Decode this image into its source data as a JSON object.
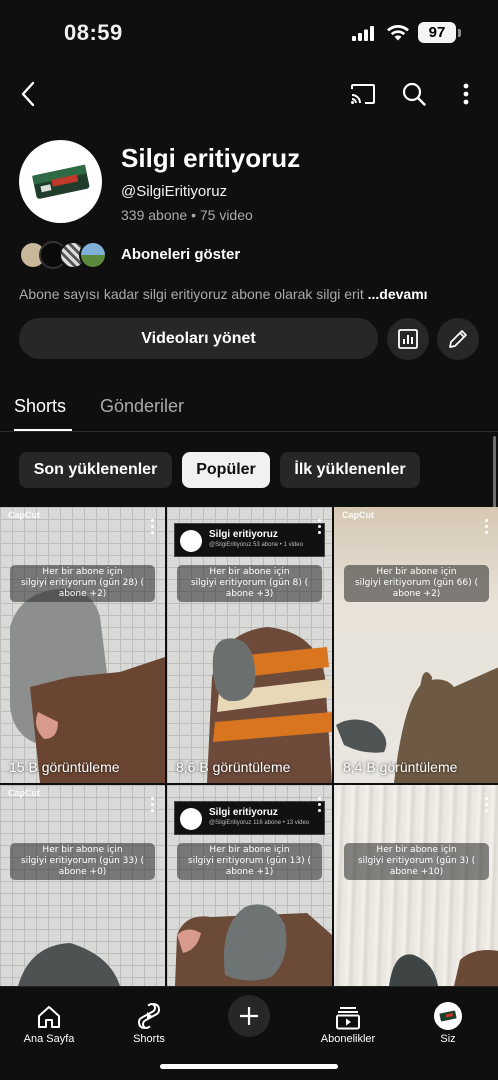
{
  "status_bar": {
    "time": "08:59",
    "battery": "97"
  },
  "channel": {
    "name": "Silgi eritiyoruz",
    "handle": "@SilgiEritiyoruz",
    "stats": "339 abone • 75 video",
    "show_subscribers_label": "Aboneleri göster",
    "description": "Abone sayısı kadar silgi eritiyoruz abone olarak silgi erit",
    "more_label": "...devamı",
    "manage_videos_label": "Videoları yönet"
  },
  "tabs": [
    {
      "label": "Shorts"
    },
    {
      "label": "Gönderiler"
    }
  ],
  "chips": [
    {
      "label": "Son yüklenenler"
    },
    {
      "label": "Popüler"
    },
    {
      "label": "İlk yüklenenler"
    }
  ],
  "shorts": [
    {
      "caption": "Her bir abone için\nsilgiyi eritiyorum (gün 28) ( abone +2)",
      "views": "15 B görüntüleme",
      "watermark": "CapCut",
      "bg": "grid"
    },
    {
      "caption": "Her bir abone için\nsilgiyi eritiyorum (gün 8) ( abone +3)",
      "views": "8,6 B görüntüleme",
      "card_name": "Silgi eritiyoruz",
      "card_handle": "@SilgiEritiyoruz",
      "card_stats": "53 abone • 1 video",
      "bg": "grid"
    },
    {
      "caption": "Her bir abone için\nsilgiyi eritiyorum (gün 66) ( abone +2)",
      "views": "8,4 B görüntüleme",
      "watermark": "CapCut",
      "bg": "sand"
    },
    {
      "caption": "Her bir abone için\nsilgiyi eritiyorum (gün 33) ( abone +0)",
      "views": "",
      "watermark": "CapCut",
      "bg": "grid"
    },
    {
      "caption": "Her bir abone için\nsilgiyi eritiyorum (gün 13) ( abone +1)",
      "views": "",
      "card_name": "Silgi eritiyoruz",
      "card_handle": "@SilgiEritiyoruz",
      "card_stats": "116 abone • 13 video",
      "bg": "grid"
    },
    {
      "caption": "Her bir abone için\nsilgiyi eritiyorum (gün 3) ( abone +10)",
      "views": "",
      "watermark": "",
      "bg": "wood"
    }
  ],
  "bottom_nav": [
    {
      "label": "Ana Sayfa",
      "icon": "home-icon"
    },
    {
      "label": "Shorts",
      "icon": "shorts-icon"
    },
    {
      "label": "",
      "icon": "create-icon"
    },
    {
      "label": "Abonelikler",
      "icon": "subscriptions-icon"
    },
    {
      "label": "Siz",
      "icon": "you-avatar-icon"
    }
  ],
  "colors": {
    "background": "#0f0f0f",
    "surface": "#272727",
    "text": "#f1f1f1",
    "muted": "#aaaaaa"
  }
}
